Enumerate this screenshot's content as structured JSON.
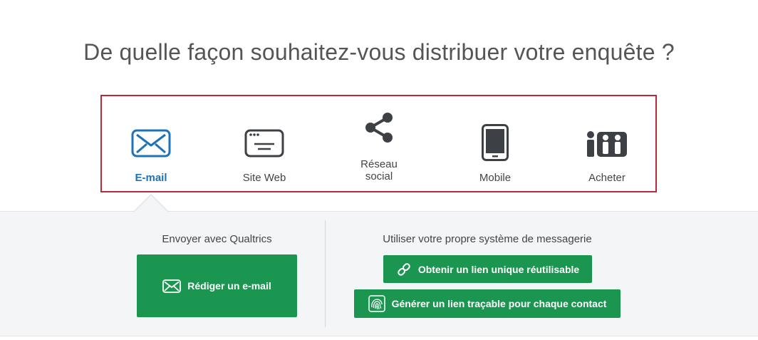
{
  "headline": "De quelle façon souhaitez-vous distribuer votre enquête ?",
  "distribution_options": [
    {
      "label": "E-mail",
      "icon": "envelope-icon",
      "active": true
    },
    {
      "label": "Site Web",
      "icon": "browser-window-icon"
    },
    {
      "label": "Réseau social",
      "label_line1": "Réseau",
      "label_line2": "social",
      "icon": "share-icon"
    },
    {
      "label": "Mobile",
      "icon": "mobile-phone-icon"
    },
    {
      "label": "Acheter",
      "icon": "people-group-icon"
    }
  ],
  "qualtrics_section": {
    "title": "Envoyer avec Qualtrics",
    "compose_button": "Rédiger un e-mail"
  },
  "own_system_section": {
    "title": "Utiliser votre propre système de messagerie",
    "anonymous_link_button": "Obtenir un lien unique réutilisable",
    "tracking_link_button": "Générer un lien traçable pour chaque contact"
  },
  "colors": {
    "highlight_border": "#b8293a",
    "active_blue": "#1e72b8",
    "button_green": "#1b9650",
    "icon_gray": "#3d4045"
  }
}
